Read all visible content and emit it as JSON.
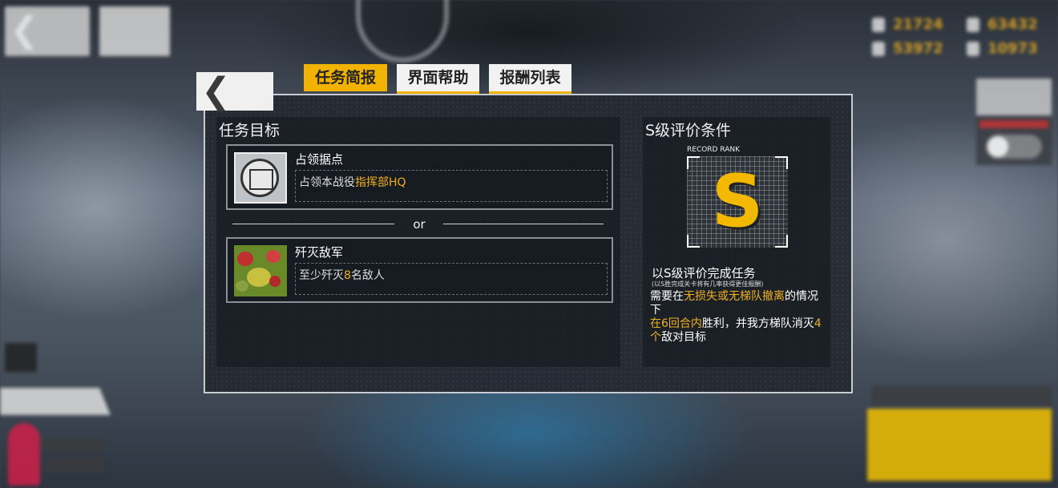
{
  "tabs": [
    {
      "label": "任务简报",
      "active": true
    },
    {
      "label": "界面帮助",
      "active": false
    },
    {
      "label": "报酬列表",
      "active": false
    }
  ],
  "objectives": {
    "title": "任务目标",
    "items": [
      {
        "name": "占领据点",
        "desc_pre": "占领本战役",
        "desc_hl": "指挥部HQ",
        "desc_post": "",
        "icon": "hq-icon"
      },
      {
        "name": "歼灭敌军",
        "desc_pre": "至少歼灭",
        "desc_hl": "8",
        "desc_post": "名敌人",
        "icon": "enemy-squad-image"
      }
    ],
    "separator": "or"
  },
  "s_rank": {
    "title": "S级评价条件",
    "label": "RECORD RANK",
    "rank": "S",
    "cond_title": "以S级评价完成任务",
    "cond_note": "(以S胜完成关卡将有几率获得更佳报酬)",
    "line1_pre": "需要在",
    "line1_hl": "无损失或无梯队撤离",
    "line1_post": "的情况下",
    "line2_hl": "在6回合内",
    "line2_post": "胜利，并我方梯队消灭",
    "line3_hl": "4个",
    "line3_post": "敌对目标"
  },
  "colors": {
    "accent": "#f2b300",
    "highlight": "#f0b020"
  }
}
